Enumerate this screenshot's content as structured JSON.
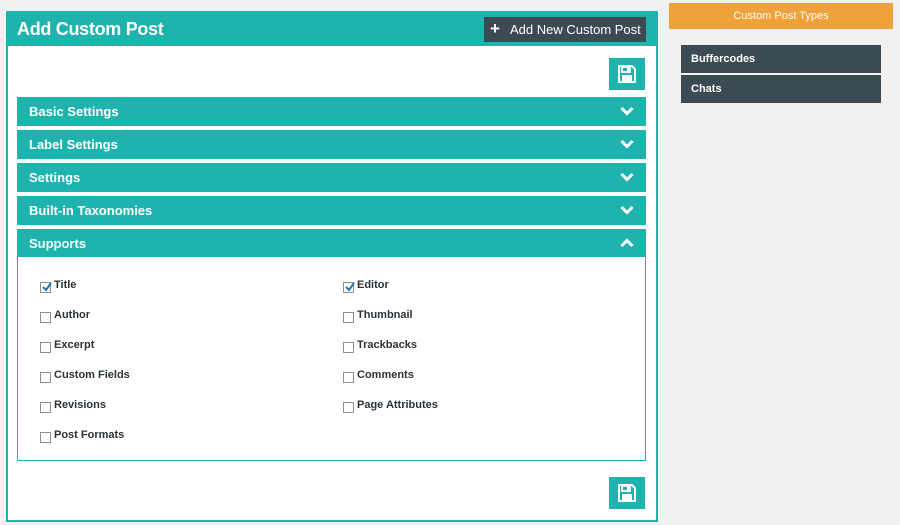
{
  "header": {
    "title": "Add Custom Post",
    "add_new_label": "Add New Custom Post"
  },
  "accordion": [
    {
      "label": "Basic Settings",
      "expanded": false
    },
    {
      "label": "Label Settings",
      "expanded": false
    },
    {
      "label": "Settings",
      "expanded": false
    },
    {
      "label": "Built-in Taxonomies",
      "expanded": false
    },
    {
      "label": "Supports",
      "expanded": true
    }
  ],
  "supports": {
    "options": [
      {
        "label": "Title",
        "checked": true
      },
      {
        "label": "Editor",
        "checked": true
      },
      {
        "label": "Author",
        "checked": false
      },
      {
        "label": "Thumbnail",
        "checked": false
      },
      {
        "label": "Excerpt",
        "checked": false
      },
      {
        "label": "Trackbacks",
        "checked": false
      },
      {
        "label": "Custom Fields",
        "checked": false
      },
      {
        "label": "Comments",
        "checked": false
      },
      {
        "label": "Revisions",
        "checked": false
      },
      {
        "label": "Page Attributes",
        "checked": false
      },
      {
        "label": "Post Formats",
        "checked": false
      }
    ]
  },
  "sidebar": {
    "title": "Custom Post Types",
    "items": [
      {
        "label": "Buffercodes"
      },
      {
        "label": "Chats"
      }
    ]
  },
  "icons": {
    "save": "save-icon",
    "add": "plus-icon",
    "collapsed": "chevron-down-icon",
    "expanded": "chevron-up-icon",
    "check": "checkmark-icon"
  },
  "colors": {
    "accent": "#1fb3ad",
    "dark": "#3c4a54",
    "sidebar_header": "#f0a13a",
    "background": "#f1f1f1"
  }
}
